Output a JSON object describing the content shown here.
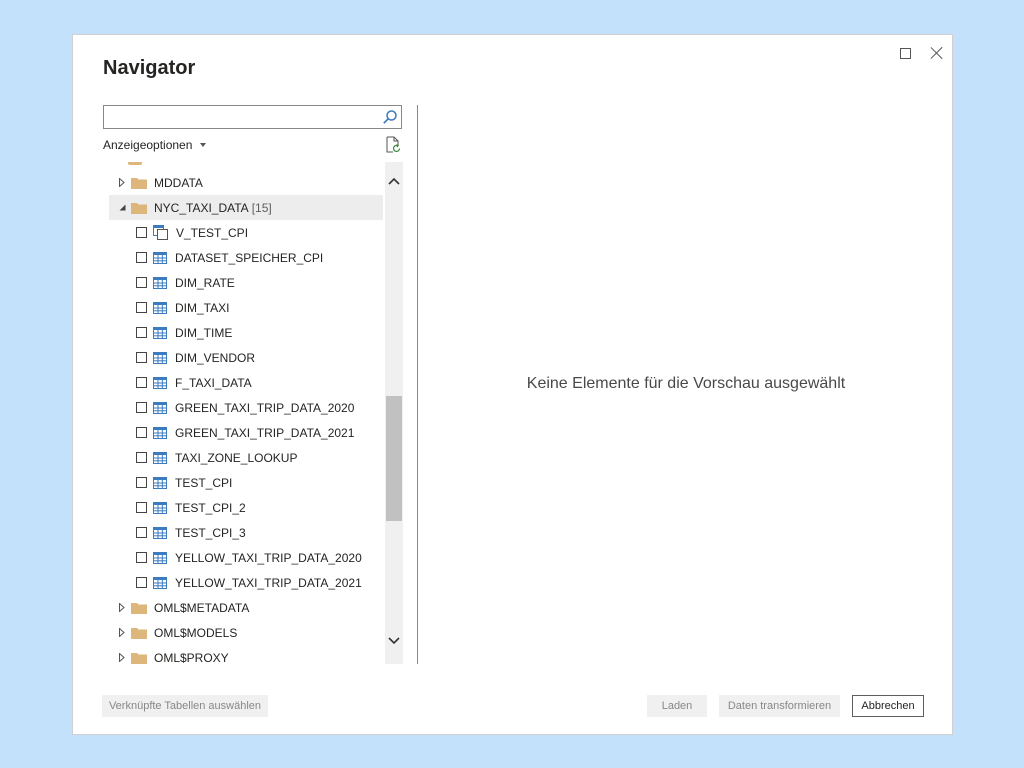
{
  "dialog": {
    "title": "Navigator"
  },
  "search": {
    "value": "",
    "placeholder": ""
  },
  "display_options": {
    "label": "Anzeigeoptionen"
  },
  "tree": {
    "items": [
      {
        "label": "MDDATA",
        "kind": "folder",
        "state": "collapsed"
      },
      {
        "label": "NYC_TAXI_DATA",
        "count": "[15]",
        "kind": "folder",
        "state": "expanded",
        "selected": true
      },
      {
        "label": "V_TEST_CPI",
        "kind": "view",
        "checked": false
      },
      {
        "label": "DATASET_SPEICHER_CPI",
        "kind": "table",
        "checked": false
      },
      {
        "label": "DIM_RATE",
        "kind": "table",
        "checked": false
      },
      {
        "label": "DIM_TAXI",
        "kind": "table",
        "checked": false
      },
      {
        "label": "DIM_TIME",
        "kind": "table",
        "checked": false
      },
      {
        "label": "DIM_VENDOR",
        "kind": "table",
        "checked": false
      },
      {
        "label": "F_TAXI_DATA",
        "kind": "table",
        "checked": false
      },
      {
        "label": "GREEN_TAXI_TRIP_DATA_2020",
        "kind": "table",
        "checked": false
      },
      {
        "label": "GREEN_TAXI_TRIP_DATA_2021",
        "kind": "table",
        "checked": false
      },
      {
        "label": "TAXI_ZONE_LOOKUP",
        "kind": "table",
        "checked": false
      },
      {
        "label": "TEST_CPI",
        "kind": "table",
        "checked": false
      },
      {
        "label": "TEST_CPI_2",
        "kind": "table",
        "checked": false
      },
      {
        "label": "TEST_CPI_3",
        "kind": "table",
        "checked": false
      },
      {
        "label": "YELLOW_TAXI_TRIP_DATA_2020",
        "kind": "table",
        "checked": false
      },
      {
        "label": "YELLOW_TAXI_TRIP_DATA_2021",
        "kind": "table",
        "checked": false
      },
      {
        "label": "OML$METADATA",
        "kind": "folder",
        "state": "collapsed"
      },
      {
        "label": "OML$MODELS",
        "kind": "folder",
        "state": "collapsed"
      },
      {
        "label": "OML$PROXY",
        "kind": "folder",
        "state": "collapsed"
      }
    ]
  },
  "preview": {
    "message": "Keine Elemente für die Vorschau ausgewählt"
  },
  "footer": {
    "linked_tables_label": "Verknüpfte Tabellen auswählen",
    "load_label": "Laden",
    "transform_label": "Daten transformieren",
    "cancel_label": "Abbrechen"
  },
  "colors": {
    "background": "#c4e1fb",
    "folder": "#dcb67a",
    "table_icon": "#3b7bbf",
    "selected_row": "#ededed"
  },
  "icons": {
    "search": "search-icon",
    "refresh": "refresh-icon",
    "folder": "folder-icon",
    "table": "table-icon",
    "view": "view-icon"
  }
}
